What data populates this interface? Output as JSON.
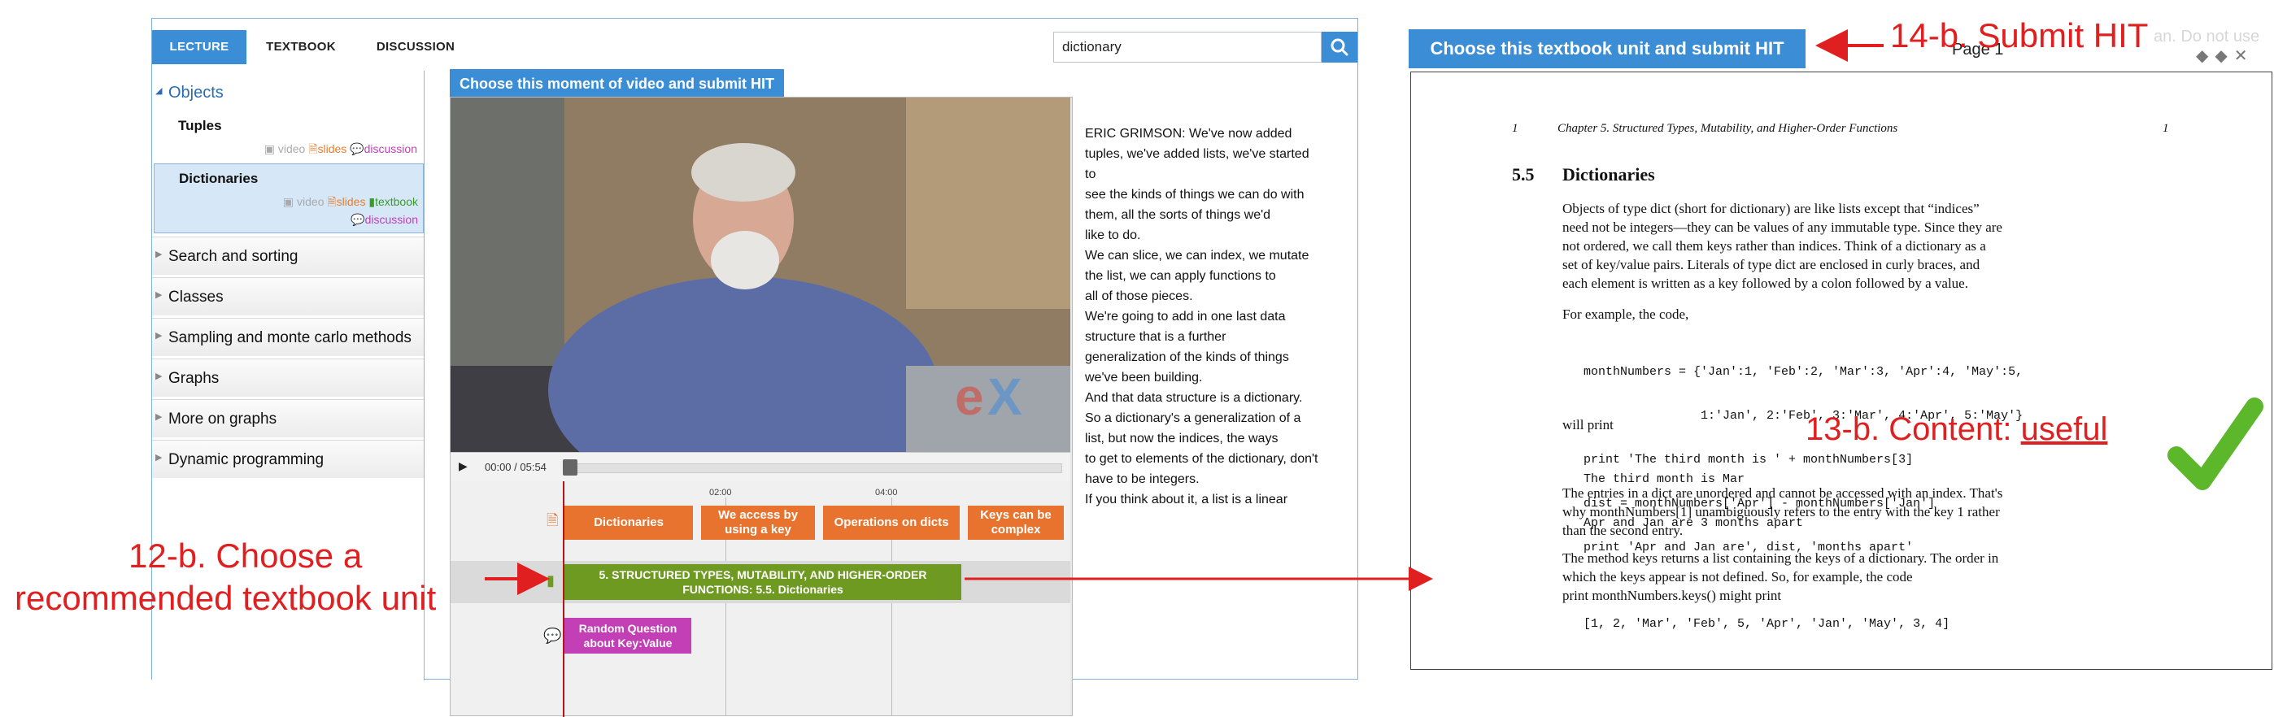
{
  "tabs": [
    "LECTURE",
    "TEXTBOOK",
    "DISCUSSION"
  ],
  "search": {
    "value": "dictionary"
  },
  "sidebar": {
    "objects": "Objects",
    "tuples": "Tuples",
    "dictionaries": "Dictionaries",
    "links": {
      "video": "video",
      "slides": "slides",
      "discussion": "discussion",
      "textbook": "textbook"
    },
    "sections": [
      "Search and sorting",
      "Classes",
      "Sampling and monte carlo methods",
      "Graphs",
      "More on graphs",
      "Dynamic programming"
    ]
  },
  "video": {
    "choose_label": "Choose this moment of video and submit HIT",
    "time": "00:00 / 05:54",
    "ticks": [
      "02:00",
      "04:00"
    ],
    "slide_segments": [
      "Dictionaries",
      "We access by using a key",
      "Operations on dicts",
      "Keys can be complex"
    ],
    "textbook_segment": "5. STRUCTURED TYPES, MUTABILITY, AND HIGHER-ORDER FUNCTIONS: 5.5. Dictionaries",
    "question_segment": "Random Question about Key:Value"
  },
  "transcript": [
    "ERIC GRIMSON: We've now added",
    "tuples, we've added lists, we've started",
    "to",
    "see the kinds of things we can do with",
    "them, all the sorts of things we'd",
    "like to do.",
    "We can slice, we can index, we mutate",
    "the list, we can apply functions to",
    "all of those pieces.",
    "We're going to add in one last data",
    "structure that is a further",
    "generalization of the kinds of things",
    "we've been building.",
    "And that data structure is a dictionary.",
    "So a dictionary's a generalization of a",
    "list, but now the indices, the ways",
    "to get to elements of the dictionary, don't",
    "have to be integers.",
    "If you think about it, a list is a linear"
  ],
  "textbook": {
    "submit_label": "Choose this textbook unit and submit HIT",
    "page_label": "Page 1",
    "faded_text": "an. Do not use",
    "running_header_left": "1",
    "running_header": "Chapter 5.  Structured Types, Mutability, and Higher-Order Functions",
    "running_header_right": "1",
    "section_number": "5.5",
    "section_title": "Dictionaries",
    "para1": [
      "Objects of type dict (short for dictionary) are like lists except that “indices”",
      "need not be integers—they can be values of any immutable type.  Since they are",
      "not ordered, we call them keys rather than indices. Think of a dictionary as a",
      "set of key/value pairs.  Literals of type dict are enclosed in curly braces, and",
      "each element is written as a key followed by a colon followed by a value."
    ],
    "para2": "For example, the code,",
    "code1": [
      "monthNumbers = {'Jan':1, 'Feb':2, 'Mar':3, 'Apr':4, 'May':5,",
      "                1:'Jan', 2:'Feb', 3:'Mar', 4:'Apr', 5:'May'}",
      "print 'The third month is ' + monthNumbers[3]",
      "dist = monthNumbers['Apr'] - monthNumbers['Jan']",
      "print 'Apr and Jan are', dist, 'months apart'"
    ],
    "will_print": "will print",
    "code2": [
      "The third month is Mar",
      "Apr and Jan are 3 months apart"
    ],
    "para3": [
      "The entries in a dict are unordered and cannot be accessed with an index. That's",
      "why monthNumbers[1]  unambiguously refers to the entry with the key 1 rather",
      "than the second entry."
    ],
    "para4": [
      "The method keys returns a list containing the keys of a dictionary.  The order in",
      "which the keys appear is not defined.  So, for example, the code",
      "print monthNumbers.keys()  might print"
    ],
    "code3": "[1, 2, 'Mar', 'Feb', 5, 'Apr', 'Jan', 'May', 3, 4]"
  },
  "annotations": {
    "submit": "14-b. Submit HIT",
    "content_prefix": "13-b. Content: ",
    "content_value": "useful",
    "choose_line1": "12-b. Choose a",
    "choose_line2": "recommended textbook unit"
  },
  "colors": {
    "accent": "#3b8ed6",
    "annotation": "#e02020",
    "slide": "#e8732e",
    "textbook": "#6f9a22",
    "question": "#c23fb5",
    "check": "#5cb82a"
  }
}
